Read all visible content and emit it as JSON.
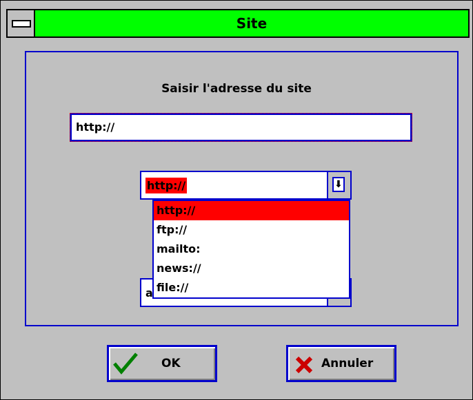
{
  "window": {
    "title": "Site"
  },
  "dialog": {
    "heading": "Saisir l'adresse du site",
    "address_value": "http://",
    "protocol_selected": "http://",
    "protocol_options": [
      "http://",
      "ftp://",
      "mailto:",
      "news://",
      "file://"
    ],
    "second_field_partial": "a"
  },
  "buttons": {
    "ok_label": "OK",
    "cancel_label": "Annuler"
  },
  "colors": {
    "title_bar": "#00ff00",
    "selection": "#ff0000",
    "border": "#0000cc"
  }
}
